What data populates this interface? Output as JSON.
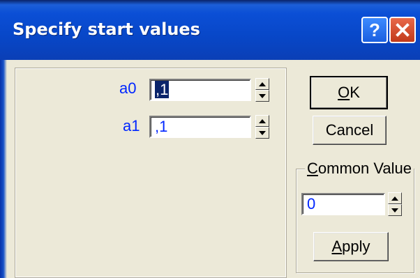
{
  "window": {
    "title": "Specify start values",
    "help_label": "?"
  },
  "params": [
    {
      "name": "a0",
      "value": ",1",
      "selected": true
    },
    {
      "name": "a1",
      "value": ",1",
      "selected": false
    }
  ],
  "buttons": {
    "ok": {
      "mnemonic": "O",
      "rest": "K"
    },
    "cancel": "Cancel",
    "apply": {
      "mnemonic": "A",
      "rest": "pply"
    }
  },
  "common": {
    "caption_mnemonic": "C",
    "caption_rest": "ommon Value",
    "value": "0"
  }
}
